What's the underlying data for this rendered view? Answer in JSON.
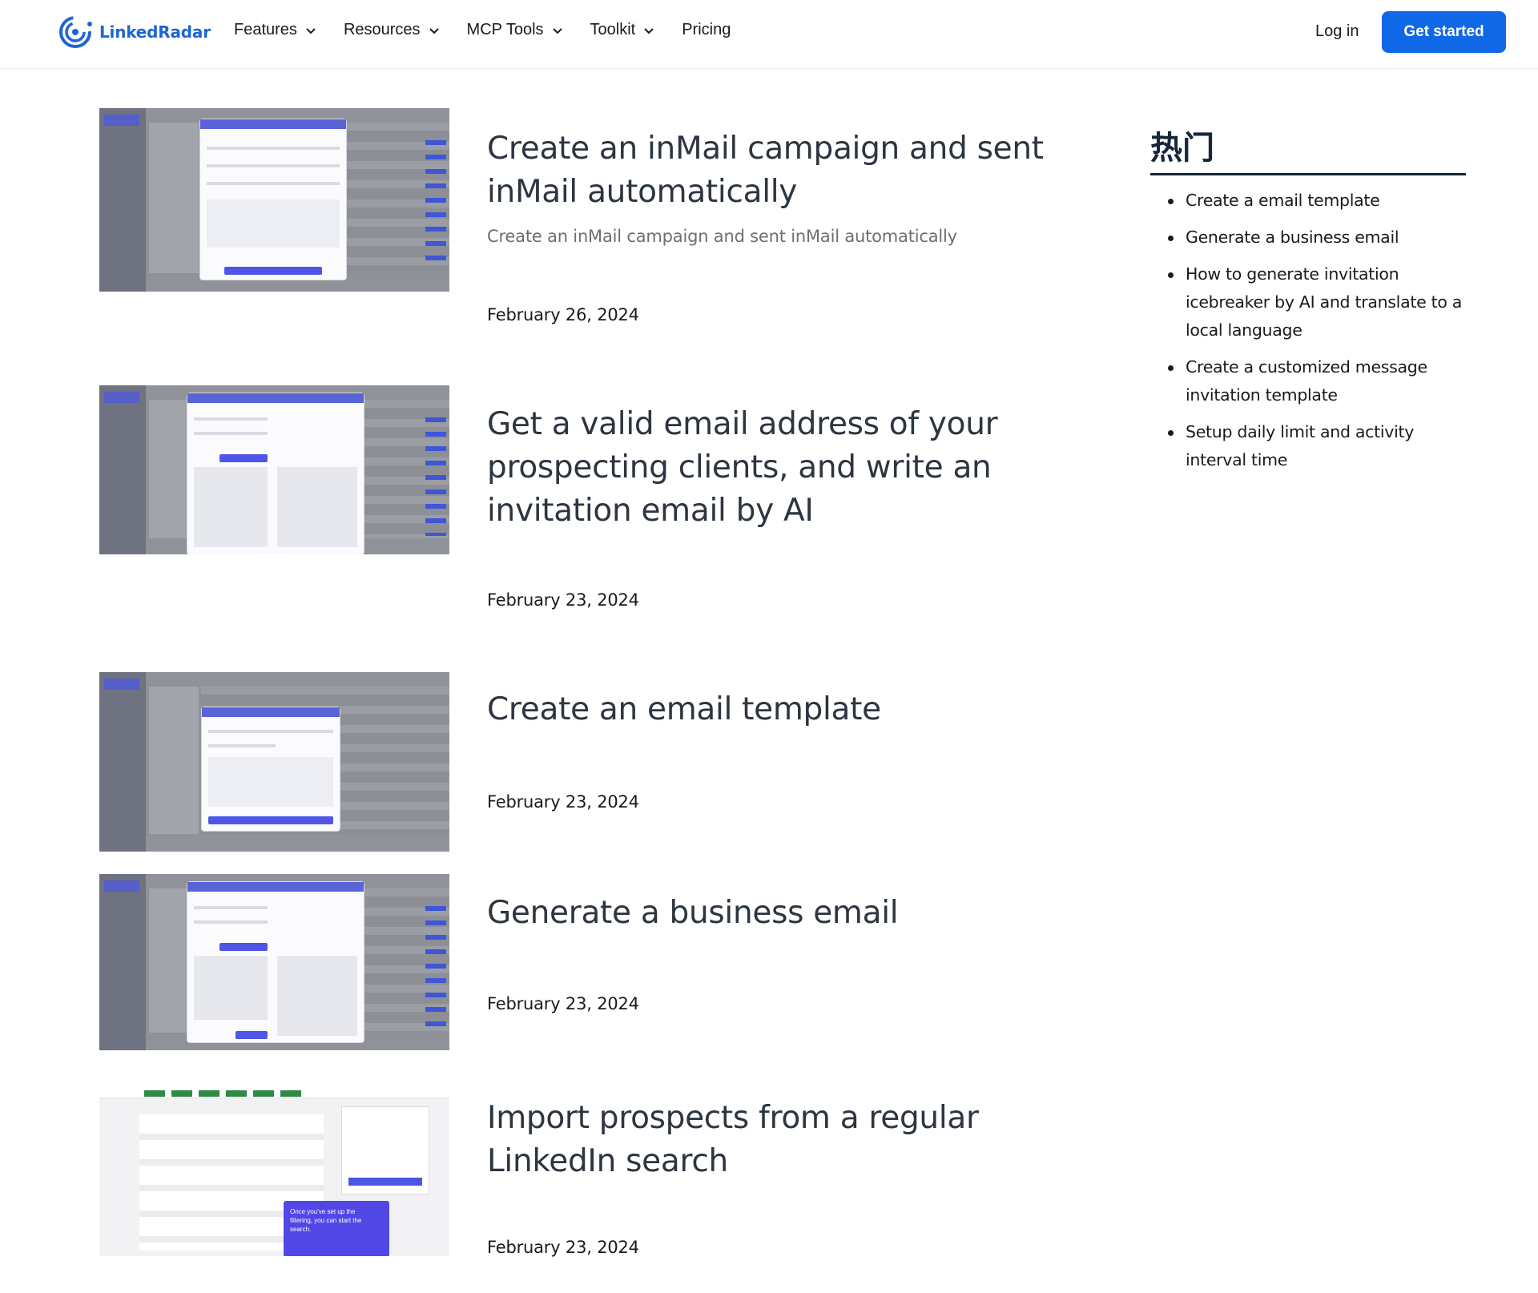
{
  "brand": {
    "name": "LinkedRadar",
    "color": "#1e64d8"
  },
  "nav": {
    "items": [
      {
        "label": "Features",
        "has_dropdown": true
      },
      {
        "label": "Resources",
        "has_dropdown": true
      },
      {
        "label": "MCP Tools",
        "has_dropdown": true
      },
      {
        "label": "Toolkit",
        "has_dropdown": true
      },
      {
        "label": "Pricing",
        "has_dropdown": false
      }
    ],
    "login_label": "Log in",
    "cta_label": "Get started",
    "cta_color": "#1168e6"
  },
  "articles": [
    {
      "title": "Create an inMail campaign and sent inMail automatically",
      "excerpt": "Create an inMail campaign and sent inMail automatically",
      "date": "February 26, 2024"
    },
    {
      "title": "Get a valid email address of your prospecting clients, and write an invitation email by AI",
      "excerpt": "",
      "date": "February 23, 2024"
    },
    {
      "title": "Create an email template",
      "excerpt": "",
      "date": "February 23, 2024"
    },
    {
      "title": "Generate a business email",
      "excerpt": "",
      "date": "February 23, 2024"
    },
    {
      "title": "Import prospects from a regular LinkedIn search",
      "excerpt": "",
      "date": "February 23, 2024",
      "thumb_caption": "Once you've set up the filtering, you can start the search."
    }
  ],
  "sidebar": {
    "title": "热门",
    "items": [
      "Create a email template",
      "Generate a business email",
      "How to generate invitation icebreaker by AI and translate to a local language",
      "Create a customized message invitation template",
      "Setup daily limit and activity interval time"
    ]
  }
}
